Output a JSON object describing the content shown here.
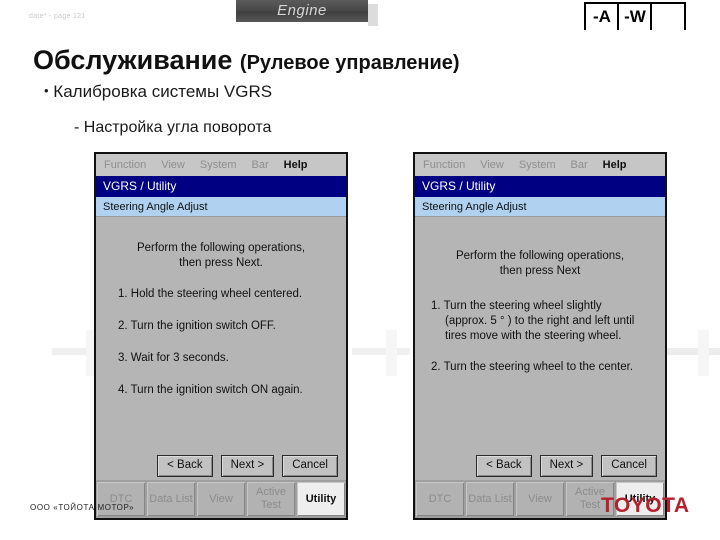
{
  "header": {
    "section_tab": "Engine",
    "slide_meta": "date* - page 121",
    "corner_boxes": [
      "-A",
      "-W",
      ""
    ]
  },
  "slide": {
    "title_main": "Обслуживание",
    "title_sub": "(Рулевое управление)",
    "bullet_marker": "•",
    "bullet": "Калибровка системы VGRS",
    "sub_bullet": "- Настройка угла поворота"
  },
  "panels": [
    {
      "menu": [
        "Function",
        "View",
        "System",
        "Bar",
        "Help"
      ],
      "menu_active": "Help",
      "title": "VGRS / Utility",
      "subtitle": "Steering Angle Adjust",
      "head_line1": "Perform the following operations,",
      "head_line2": "then press Next.",
      "steps": [
        {
          "text": "1. Hold the steering wheel centered.",
          "cont": ""
        },
        {
          "text": "2. Turn the ignition switch OFF.",
          "cont": ""
        },
        {
          "text": "3. Wait for 3 seconds.",
          "cont": ""
        },
        {
          "text": "4. Turn the ignition switch ON again.",
          "cont": ""
        }
      ],
      "buttons": [
        "< Back",
        "Next >",
        "Cancel"
      ],
      "tabs": [
        "DTC",
        "Data List",
        "View",
        "Active Test",
        "Utility"
      ],
      "tab_active": "Utility"
    },
    {
      "menu": [
        "Function",
        "View",
        "System",
        "Bar",
        "Help"
      ],
      "menu_active": "Help",
      "title": "VGRS / Utility",
      "subtitle": "Steering Angle Adjust",
      "head_line1": "Perform the following operations,",
      "head_line2": "then press Next",
      "steps": [
        {
          "text": "1. Turn the steering wheel slightly",
          "cont": "(approx. 5 ° ) to the right and left until"
        },
        {
          "text": "",
          "cont": "tires move with the steering wheel."
        },
        {
          "text": "2. Turn the steering wheel to the center.",
          "cont": ""
        }
      ],
      "buttons": [
        "< Back",
        "Next >",
        "Cancel"
      ],
      "tabs": [
        "DTC",
        "Data List",
        "View",
        "Active Test",
        "Utility"
      ],
      "tab_active": "Utility"
    }
  ],
  "footer": {
    "company": "ООО «ТОЙОТА МОТОР»",
    "logo": "TOYOTA",
    "logo_color": "#b5202d"
  }
}
